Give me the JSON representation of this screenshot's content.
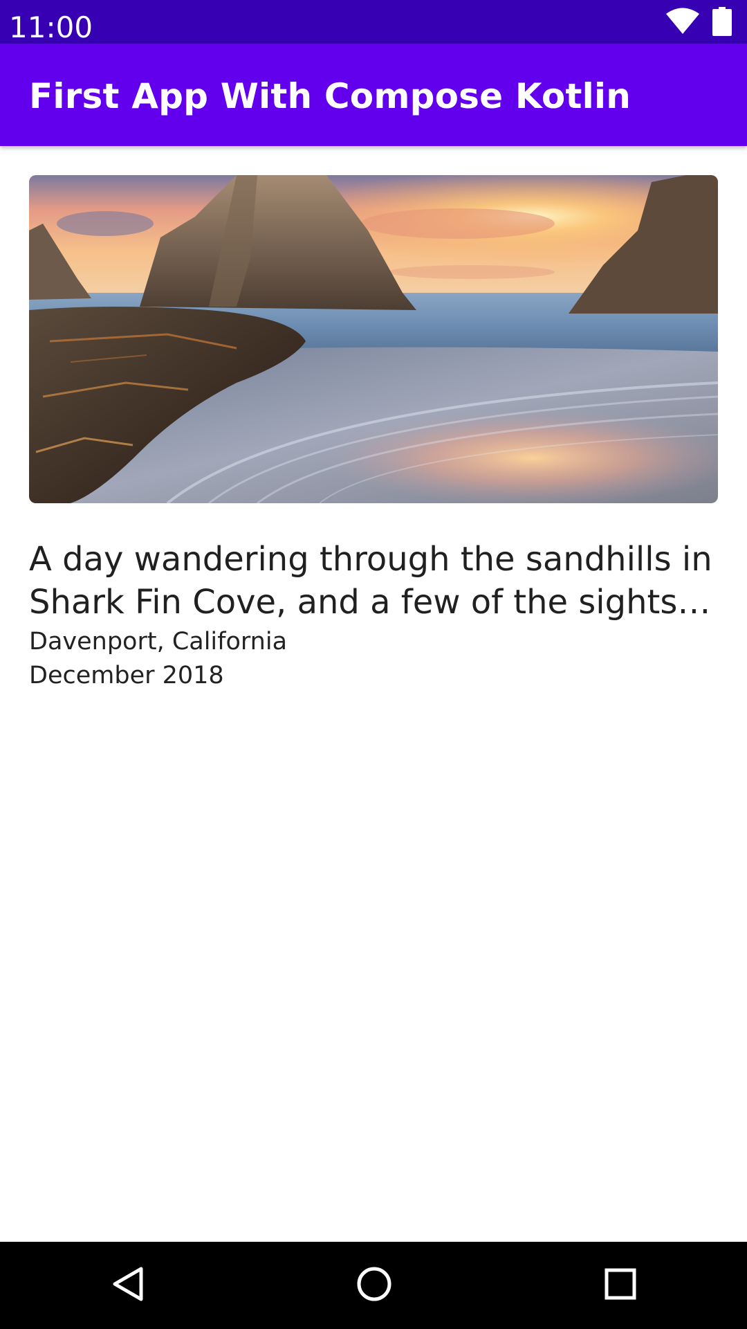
{
  "status_bar": {
    "time": "11:00",
    "icons": [
      "wifi-icon",
      "battery-icon"
    ]
  },
  "app_bar": {
    "title": "First App With Compose Kotlin"
  },
  "article": {
    "image": "sunset-beach-rocks",
    "headline": "A day wandering through the sandhills in Shark Fin Cove, and a few of the sights I …",
    "location": "Davenport, California",
    "date": "December 2018"
  },
  "nav_bar": {
    "buttons": [
      "back-icon",
      "home-icon",
      "recents-icon"
    ]
  },
  "colors": {
    "status_bar": "#3700B3",
    "app_bar": "#6200EE",
    "nav_bar": "#000000",
    "text": "#202020"
  }
}
